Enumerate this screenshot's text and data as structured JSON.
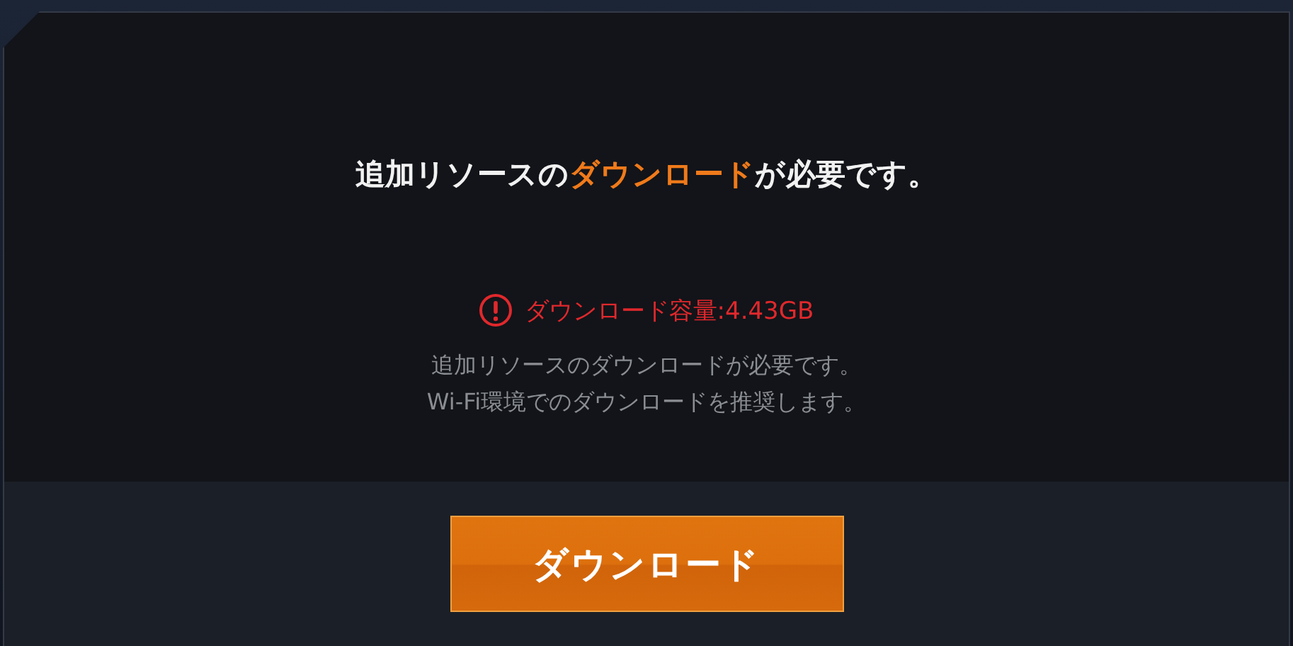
{
  "dialog": {
    "title_parts": [
      {
        "text": "追加リソースの",
        "highlight": false
      },
      {
        "text": "ダウンロード",
        "highlight": true
      },
      {
        "text": "が必要です。",
        "highlight": false
      }
    ],
    "warning": "ダウンロード容量:4.43GB",
    "message_lines": [
      "追加リソースのダウンロードが必要です。",
      "Wi-Fi環境でのダウンロードを推奨します。"
    ],
    "button": "ダウンロード"
  }
}
